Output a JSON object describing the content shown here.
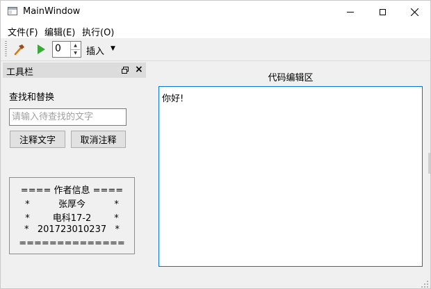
{
  "window": {
    "title": "MainWindow"
  },
  "menu": {
    "items": [
      "文件(F)",
      "编辑(E)",
      "执行(O)"
    ]
  },
  "toolbar": {
    "spin_value": "0",
    "insert_label": "插入"
  },
  "dock": {
    "title": "工具栏",
    "section_label": "查找和替换",
    "search_placeholder": "请输入待查找的文字",
    "comment_button": "注释文字",
    "uncomment_button": "取消注释",
    "author_lines": [
      "==== 作者信息 ====",
      "*          张厚今          *",
      "*        电科17-2        *",
      "*   201723010237   *",
      "=============="
    ]
  },
  "editor": {
    "label": "代码编辑区",
    "content": "你好!"
  },
  "icons": {
    "hammer": "hammer-icon",
    "run": "play-icon"
  },
  "colors": {
    "accent": "#0078d7",
    "run_green": "#3aa935"
  }
}
